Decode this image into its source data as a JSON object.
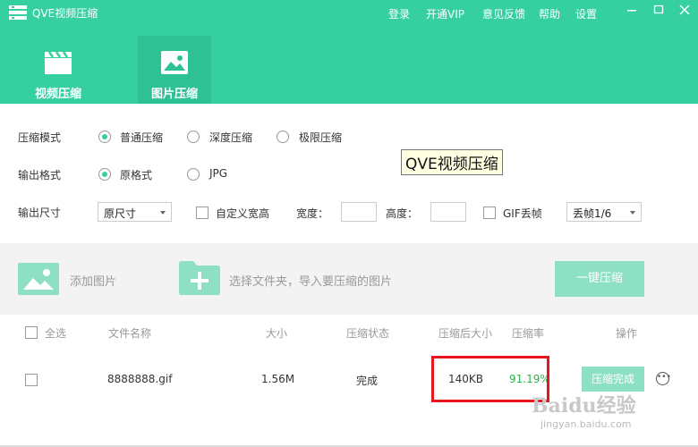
{
  "app": {
    "title": "QVE视频压缩"
  },
  "menu": {
    "login": "登录",
    "vip": "开通VIP",
    "feedback": "意见反馈",
    "help": "帮助",
    "settings": "设置"
  },
  "tabs": [
    {
      "label": "视频压缩",
      "icon": "clapperboard-icon"
    },
    {
      "label": "图片压缩",
      "icon": "image-icon",
      "active": true
    }
  ],
  "options": {
    "compress_mode_label": "压缩模式",
    "compress_modes": [
      "普通压缩",
      "深度压缩",
      "极限压缩"
    ],
    "compress_mode_selected": "普通压缩",
    "output_format_label": "输出格式",
    "output_formats": [
      "原格式",
      "JPG"
    ],
    "output_format_selected": "原格式",
    "output_size_label": "输出尺寸",
    "output_size_value": "原尺寸",
    "custom_wh_label": "自定义宽高",
    "width_label": "宽度：",
    "height_label": "高度：",
    "gif_drop_label": "GIF丢帧",
    "gif_drop_value": "丢帧1/6"
  },
  "tooltip": "QVE视频压缩",
  "toolbar": {
    "add_image": "添加图片",
    "choose_folder": "选择文件夹，导入要压缩的图片",
    "one_click": "一键压缩"
  },
  "table": {
    "headers": {
      "select_all": "全选",
      "file_name": "文件名称",
      "size": "大小",
      "status": "压缩状态",
      "after_size": "压缩后大小",
      "rate": "压缩率",
      "action": "操作"
    },
    "rows": [
      {
        "file_name": "8888888.gif",
        "size": "1.56M",
        "status": "完成",
        "after_size": "140KB",
        "rate": "91.19%",
        "action_label": "压缩完成"
      }
    ]
  },
  "colors": {
    "brand": "#36d0a0",
    "brand_dark": "#2ec193",
    "brand_light": "#8ee0c4",
    "highlight": "#e8141e",
    "rate_green": "#2bb24c"
  },
  "watermark": {
    "brand": "Baidu经验",
    "url": "jingyan.baidu.com"
  }
}
